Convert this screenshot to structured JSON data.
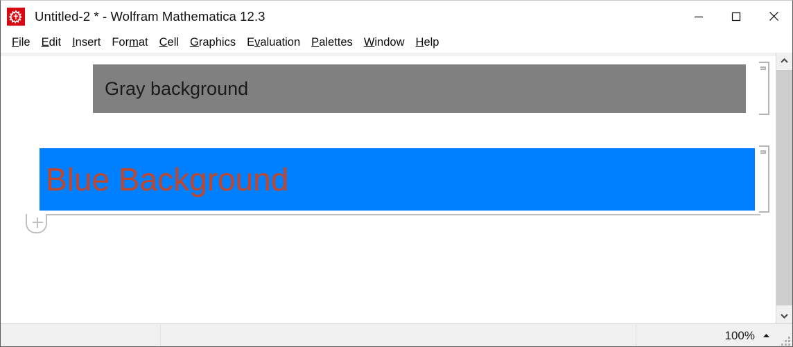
{
  "window": {
    "title": "Untitled-2 * - Wolfram Mathematica 12.3",
    "app_icon": "mathematica-spikey-icon",
    "controls": {
      "minimize": "minimize-icon",
      "maximize": "maximize-icon",
      "close": "close-icon"
    }
  },
  "menu": {
    "items": [
      {
        "pre": "",
        "key": "F",
        "post": "ile"
      },
      {
        "pre": "",
        "key": "E",
        "post": "dit"
      },
      {
        "pre": "",
        "key": "I",
        "post": "nsert"
      },
      {
        "pre": "For",
        "key": "m",
        "post": "at"
      },
      {
        "pre": "",
        "key": "C",
        "post": "ell"
      },
      {
        "pre": "",
        "key": "G",
        "post": "raphics"
      },
      {
        "pre": "E",
        "key": "v",
        "post": "aluation"
      },
      {
        "pre": "",
        "key": "P",
        "post": "alettes"
      },
      {
        "pre": "",
        "key": "W",
        "post": "indow"
      },
      {
        "pre": "",
        "key": "H",
        "post": "elp"
      }
    ]
  },
  "notebook": {
    "cells": [
      {
        "name": "cell-gray-background",
        "text": "Gray background",
        "background": "#808080",
        "text_color": "#1a1a1a"
      },
      {
        "name": "cell-blue-background",
        "text": "Blue Background",
        "background": "#0080ff",
        "text_color": "#c0472b"
      }
    ],
    "insertion_point": "+"
  },
  "status_bar": {
    "zoom_level": "100%",
    "zoom_caret": "caret-up-icon"
  },
  "scrollbar": {
    "up_arrow": "chevron-up-icon",
    "down_arrow": "chevron-down-icon"
  }
}
